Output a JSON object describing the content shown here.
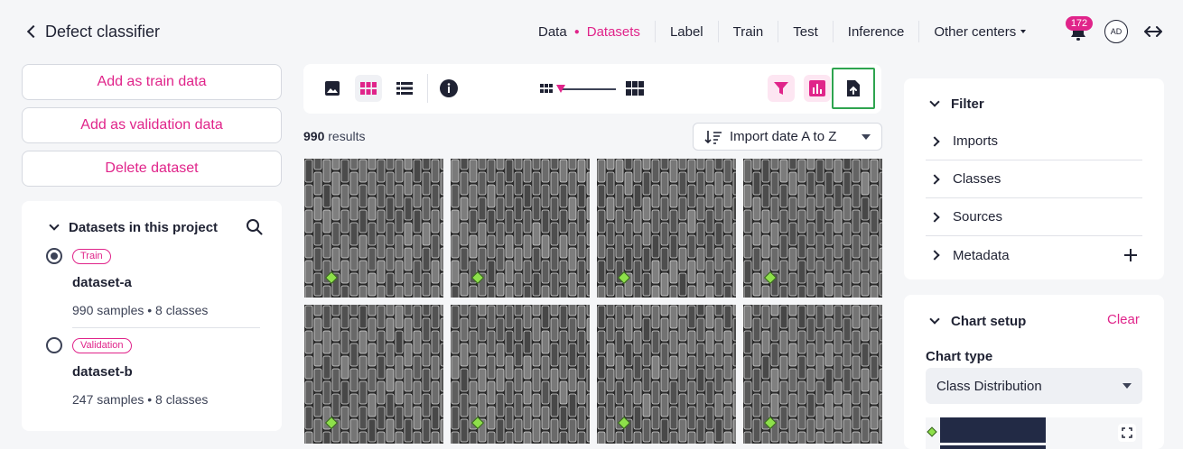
{
  "header": {
    "title": "Defect classifier",
    "nav": [
      {
        "label": "Data",
        "active": false
      },
      {
        "label": "Datasets",
        "active": true
      },
      {
        "label": "Label",
        "active": false
      },
      {
        "label": "Train",
        "active": false
      },
      {
        "label": "Test",
        "active": false
      },
      {
        "label": "Inference",
        "active": false
      },
      {
        "label": "Other centers",
        "active": false
      }
    ],
    "notification_count": "172",
    "avatar_initials": "AD"
  },
  "actions": {
    "add_train": "Add as train data",
    "add_validation": "Add as validation data",
    "delete": "Delete dataset"
  },
  "datasets_panel": {
    "title": "Datasets in this project",
    "items": [
      {
        "tag": "Train",
        "name": "dataset-a",
        "info": "990 samples • 8 classes",
        "selected": true
      },
      {
        "tag": "Validation",
        "name": "dataset-b",
        "info": "247 samples • 8 classes",
        "selected": false
      }
    ]
  },
  "toolbar": {
    "icons": [
      "image-view-icon",
      "grid-view-icon",
      "list-view-icon",
      "info-icon",
      "filter-icon",
      "chart-icon",
      "export-icon"
    ]
  },
  "results": {
    "count": "990",
    "label": "results"
  },
  "sort": {
    "label": "Import date A to Z"
  },
  "filter_panel": {
    "title": "Filter",
    "items": [
      "Imports",
      "Classes",
      "Sources",
      "Metadata"
    ]
  },
  "chart_setup": {
    "title": "Chart setup",
    "clear_label": "Clear",
    "chart_type_label": "Chart type",
    "chart_type_value": "Class Distribution"
  },
  "colors": {
    "accent": "#e0248a",
    "highlight_border": "#2ea44f",
    "class_marker": "#8ee04a",
    "chart_bar": "#222a45"
  }
}
